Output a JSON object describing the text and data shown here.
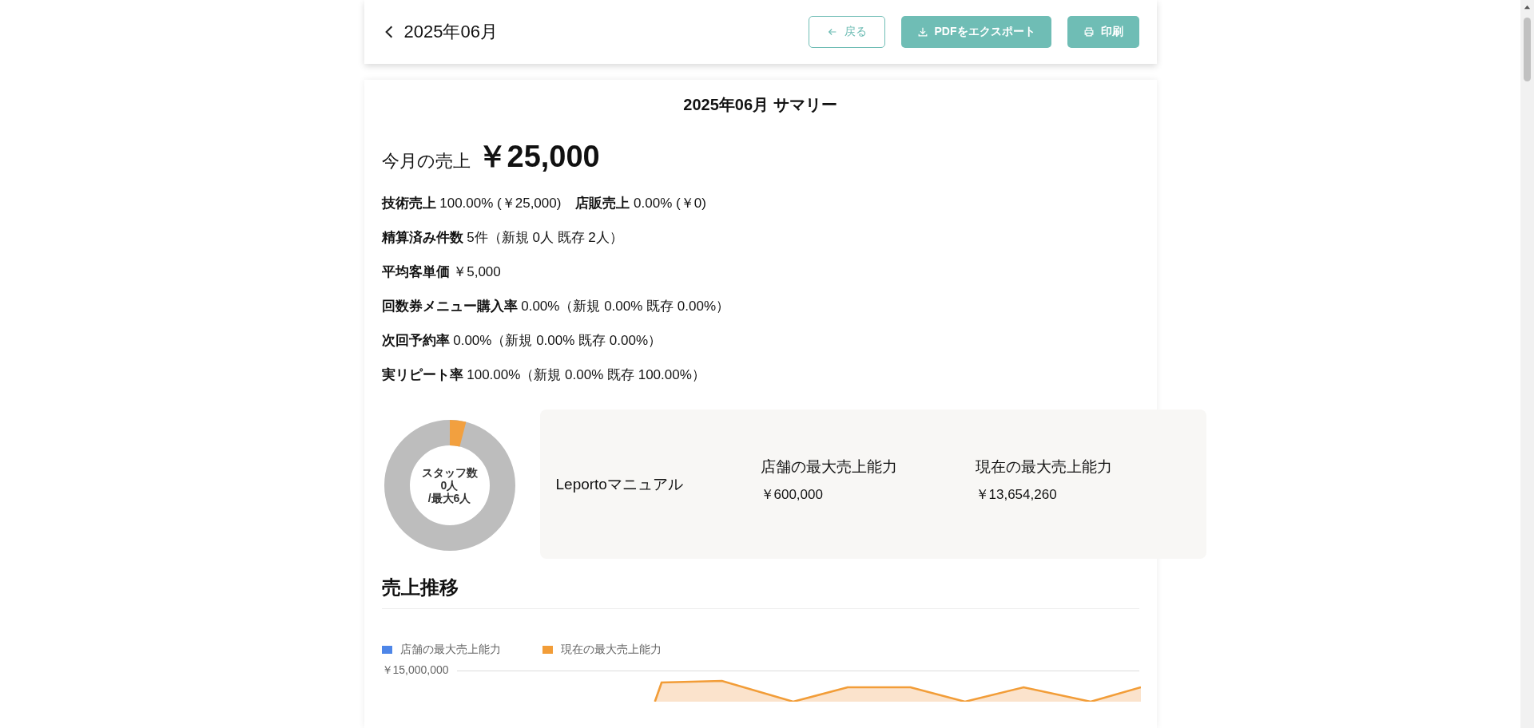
{
  "header": {
    "title": "2025年06月",
    "buttons": [
      {
        "kind": "back",
        "label": "戻る"
      },
      {
        "kind": "export",
        "label": "PDFをエクスポート"
      },
      {
        "kind": "print",
        "label": "印刷"
      }
    ]
  },
  "summary": {
    "title": "2025年06月 サマリー",
    "sales_label": "今月の売上",
    "sales_amount": "￥25,000",
    "metrics": [
      {
        "parts": [
          {
            "label": "技術売上",
            "value": "100.00% (￥25,000)"
          },
          {
            "label": "店販売上",
            "value": "0.00% (￥0)"
          }
        ]
      },
      {
        "parts": [
          {
            "label": "精算済み件数",
            "value": "5件（新規 0人 既存 2人）"
          }
        ]
      },
      {
        "parts": [
          {
            "label": "平均客単価",
            "value": "￥5,000"
          }
        ]
      },
      {
        "parts": [
          {
            "label": "回数券メニュー購入率",
            "value": "0.00%（新規 0.00% 既存 0.00%）"
          }
        ]
      },
      {
        "parts": [
          {
            "label": "次回予約率",
            "value": "0.00%（新規 0.00% 既存 0.00%）"
          }
        ]
      },
      {
        "parts": [
          {
            "label": "実リピート率",
            "value": "100.00%（新規 0.00% 既存 100.00%）"
          }
        ]
      }
    ]
  },
  "staff": {
    "lines": [
      "スタッフ数",
      "0人",
      "/最大6人"
    ]
  },
  "capacity": {
    "name": "Leportoマニュアル",
    "columns": [
      {
        "label": "店舗の最大売上能力",
        "value": "￥600,000"
      },
      {
        "label": "現在の最大売上能力",
        "value": "￥13,654,260"
      }
    ]
  },
  "trend": {
    "title": "売上推移",
    "legend": [
      {
        "label": "店舗の最大売上能力",
        "color": "#4e86e8"
      },
      {
        "label": "現在の最大売上能力",
        "color": "#f29d38"
      }
    ],
    "tick_label": "￥15,000,000"
  }
}
